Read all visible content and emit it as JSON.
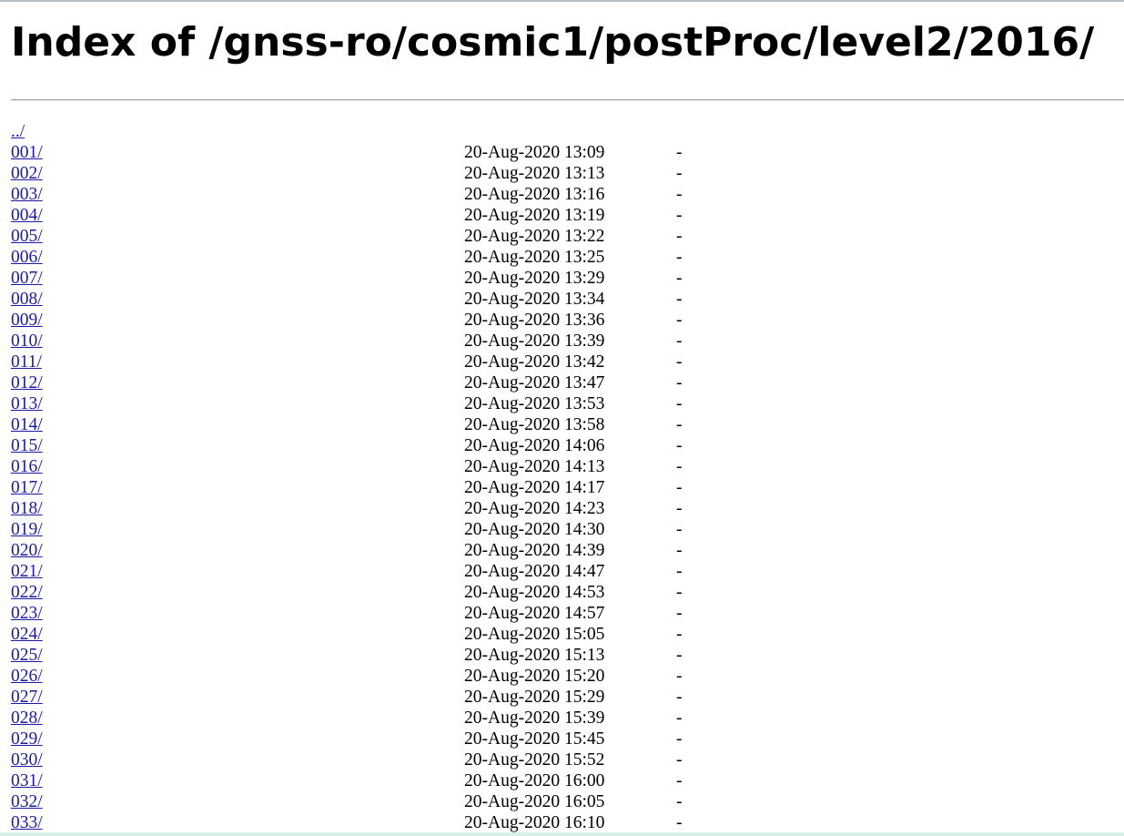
{
  "page": {
    "title": "Index of /gnss-ro/cosmic1/postProc/level2/2016/"
  },
  "parent": {
    "name": "../"
  },
  "entries": [
    {
      "name": "001/",
      "date": "20-Aug-2020 13:09",
      "size": "-"
    },
    {
      "name": "002/",
      "date": "20-Aug-2020 13:13",
      "size": "-"
    },
    {
      "name": "003/",
      "date": "20-Aug-2020 13:16",
      "size": "-"
    },
    {
      "name": "004/",
      "date": "20-Aug-2020 13:19",
      "size": "-"
    },
    {
      "name": "005/",
      "date": "20-Aug-2020 13:22",
      "size": "-"
    },
    {
      "name": "006/",
      "date": "20-Aug-2020 13:25",
      "size": "-"
    },
    {
      "name": "007/",
      "date": "20-Aug-2020 13:29",
      "size": "-"
    },
    {
      "name": "008/",
      "date": "20-Aug-2020 13:34",
      "size": "-"
    },
    {
      "name": "009/",
      "date": "20-Aug-2020 13:36",
      "size": "-"
    },
    {
      "name": "010/",
      "date": "20-Aug-2020 13:39",
      "size": "-"
    },
    {
      "name": "011/",
      "date": "20-Aug-2020 13:42",
      "size": "-"
    },
    {
      "name": "012/",
      "date": "20-Aug-2020 13:47",
      "size": "-"
    },
    {
      "name": "013/",
      "date": "20-Aug-2020 13:53",
      "size": "-"
    },
    {
      "name": "014/",
      "date": "20-Aug-2020 13:58",
      "size": "-"
    },
    {
      "name": "015/",
      "date": "20-Aug-2020 14:06",
      "size": "-"
    },
    {
      "name": "016/",
      "date": "20-Aug-2020 14:13",
      "size": "-"
    },
    {
      "name": "017/",
      "date": "20-Aug-2020 14:17",
      "size": "-"
    },
    {
      "name": "018/",
      "date": "20-Aug-2020 14:23",
      "size": "-"
    },
    {
      "name": "019/",
      "date": "20-Aug-2020 14:30",
      "size": "-"
    },
    {
      "name": "020/",
      "date": "20-Aug-2020 14:39",
      "size": "-"
    },
    {
      "name": "021/",
      "date": "20-Aug-2020 14:47",
      "size": "-"
    },
    {
      "name": "022/",
      "date": "20-Aug-2020 14:53",
      "size": "-"
    },
    {
      "name": "023/",
      "date": "20-Aug-2020 14:57",
      "size": "-"
    },
    {
      "name": "024/",
      "date": "20-Aug-2020 15:05",
      "size": "-"
    },
    {
      "name": "025/",
      "date": "20-Aug-2020 15:13",
      "size": "-"
    },
    {
      "name": "026/",
      "date": "20-Aug-2020 15:20",
      "size": "-"
    },
    {
      "name": "027/",
      "date": "20-Aug-2020 15:29",
      "size": "-"
    },
    {
      "name": "028/",
      "date": "20-Aug-2020 15:39",
      "size": "-"
    },
    {
      "name": "029/",
      "date": "20-Aug-2020 15:45",
      "size": "-"
    },
    {
      "name": "030/",
      "date": "20-Aug-2020 15:52",
      "size": "-"
    },
    {
      "name": "031/",
      "date": "20-Aug-2020 16:00",
      "size": "-"
    },
    {
      "name": "032/",
      "date": "20-Aug-2020 16:05",
      "size": "-"
    },
    {
      "name": "033/",
      "date": "20-Aug-2020 16:10",
      "size": "-"
    }
  ],
  "colors": {
    "link": "#1a1aa6",
    "text": "#000000",
    "background": "#ffffff"
  }
}
